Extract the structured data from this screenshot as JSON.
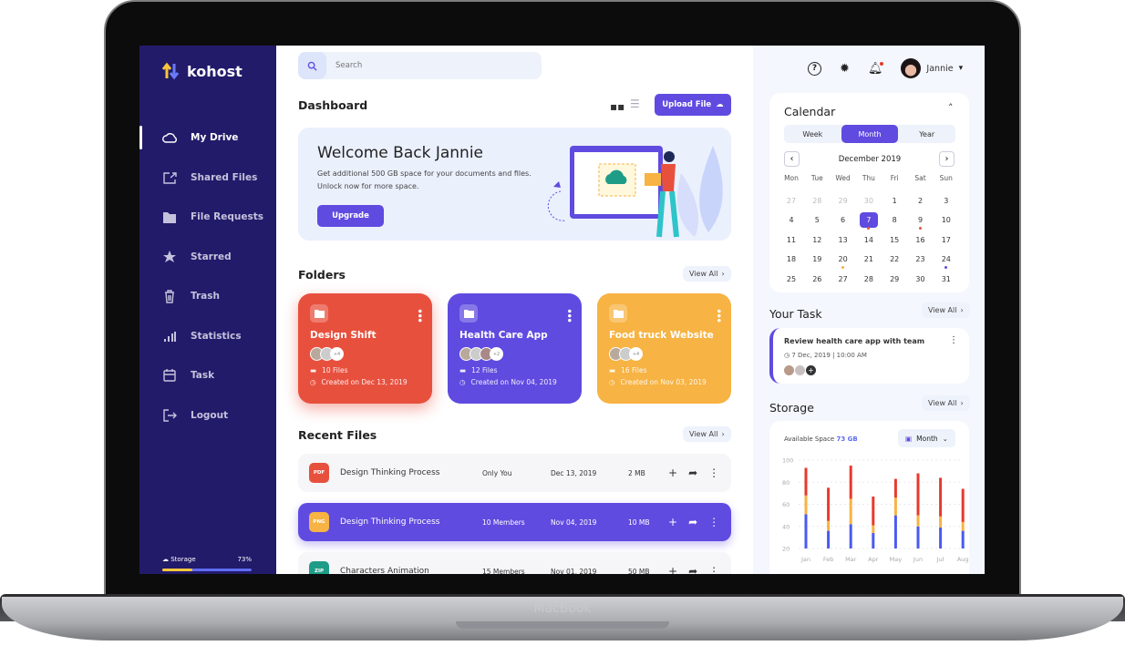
{
  "device": {
    "label": "MacBook"
  },
  "app": {
    "name": "kohost"
  },
  "sidebar": {
    "items": [
      {
        "label": "My Drive",
        "icon": "cloud-icon",
        "active": true
      },
      {
        "label": "Shared Files",
        "icon": "share-icon"
      },
      {
        "label": "File Requests",
        "icon": "folder-icon"
      },
      {
        "label": "Starred",
        "icon": "star-icon"
      },
      {
        "label": "Trash",
        "icon": "trash-icon"
      },
      {
        "label": "Statistics",
        "icon": "bar-chart-icon"
      },
      {
        "label": "Task",
        "icon": "calendar-icon"
      },
      {
        "label": "Logout",
        "icon": "logout-icon"
      }
    ],
    "storage": {
      "label": "Storage",
      "percent_label": "73%",
      "percent": 73
    }
  },
  "search": {
    "placeholder": "Search"
  },
  "header": {
    "title": "Dashboard",
    "upload_label": "Upload File",
    "user": "Jannie"
  },
  "banner": {
    "title": "Welcome Back Jannie",
    "text": "Get additional 500 GB space for your documents and files. Unlock now for more space.",
    "button": "Upgrade"
  },
  "folders": {
    "title": "Folders",
    "view_all": "View All",
    "items": [
      {
        "name": "Design Shift",
        "extra": "+4",
        "files": "10 Files",
        "created": "Created on Dec 13, 2019",
        "color": "#e8503e"
      },
      {
        "name": "Health Care App",
        "extra": "+2",
        "files": "12 Files",
        "created": "Created on Nov 04, 2019",
        "color": "#5f4be0"
      },
      {
        "name": "Food truck Website",
        "extra": "+4",
        "files": "16 Files",
        "created": "Created on Nov 03, 2019",
        "color": "#f7b343"
      }
    ]
  },
  "recent": {
    "title": "Recent Files",
    "view_all": "View All",
    "rows": [
      {
        "type": "PDF",
        "name": "Design Thinking Process",
        "share": "Only You",
        "date": "Dec 13, 2019",
        "size": "2 MB",
        "color": "#e8503e"
      },
      {
        "type": "PNG",
        "name": "Design Thinking Process",
        "share": "10 Members",
        "date": "Nov 04, 2019",
        "size": "10 MB",
        "color": "#f7b343",
        "selected": true
      },
      {
        "type": "ZIP",
        "name": "Characters Animation",
        "share": "15 Members",
        "date": "Nov 01, 2019",
        "size": "50 MB",
        "color": "#1f9c87"
      }
    ]
  },
  "calendar": {
    "title": "Calendar",
    "tabs": [
      "Week",
      "Month",
      "Year"
    ],
    "active_tab": "Month",
    "month": "December 2019",
    "weekdays": [
      "Mon",
      "Tue",
      "Wed",
      "Thu",
      "Fri",
      "Sat",
      "Sun"
    ],
    "weeks": [
      [
        "27",
        "28",
        "29",
        "30",
        "1",
        "2",
        "3"
      ],
      [
        "4",
        "5",
        "6",
        "7",
        "8",
        "9",
        "10"
      ],
      [
        "11",
        "12",
        "13",
        "14",
        "15",
        "16",
        "17"
      ],
      [
        "18",
        "19",
        "20",
        "21",
        "22",
        "23",
        "24"
      ],
      [
        "25",
        "26",
        "27",
        "28",
        "29",
        "30",
        "31"
      ]
    ],
    "selected": "7",
    "events": {
      "7": "#e8503e",
      "9": "#e8503e",
      "20": "#f7b343",
      "24": "#5f4be0"
    }
  },
  "task": {
    "title": "Your Task",
    "view_all": "View All",
    "item": {
      "title": "Review health care app with team",
      "date": "7 Dec, 2019",
      "time": "10:00 AM"
    }
  },
  "storage": {
    "title": "Storage",
    "view_all": "View All",
    "available_label": "Available Space",
    "available_value": "73 GB",
    "period": "Month"
  },
  "chart_data": {
    "type": "bar",
    "stacked": true,
    "categories": [
      "Jan",
      "Feb",
      "Mar",
      "Apr",
      "May",
      "Jun",
      "Jul",
      "Aug"
    ],
    "ylim": [
      20,
      100
    ],
    "yticks": [
      "100",
      "80",
      "60",
      "40",
      "20"
    ],
    "grid": true,
    "series": [
      {
        "color": "#4a5af0",
        "values": [
          51,
          36,
          42,
          34,
          50,
          40,
          39,
          36
        ]
      },
      {
        "color": "#f7b343",
        "values": [
          17,
          9,
          23,
          7,
          16,
          10,
          10,
          8
        ]
      },
      {
        "color": "#e8392e",
        "values": [
          25,
          30,
          30,
          26,
          17,
          38,
          35,
          30
        ]
      }
    ]
  }
}
